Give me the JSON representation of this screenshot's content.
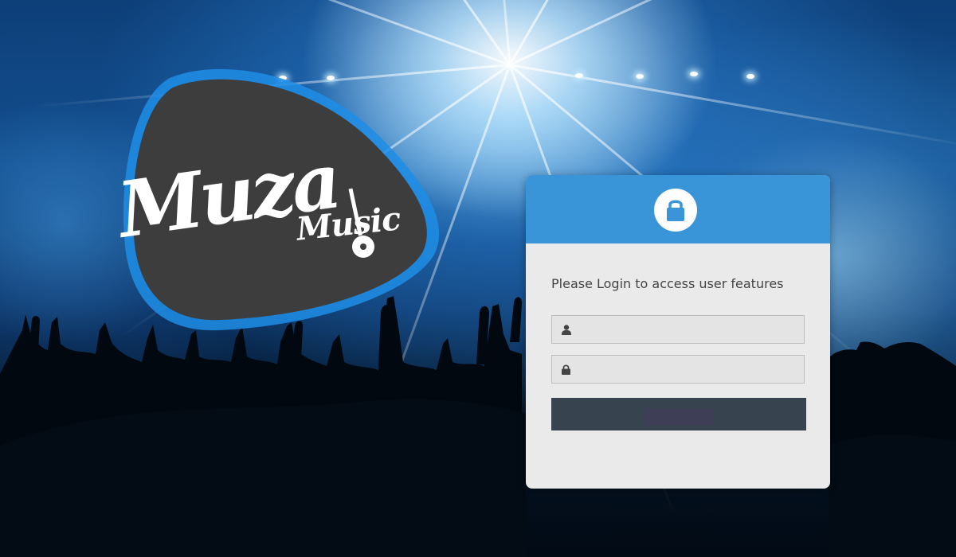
{
  "brand": {
    "name": "Muza",
    "tagline": "Music"
  },
  "login": {
    "message": "Please Login to access user features",
    "username": {
      "value": "",
      "placeholder": "",
      "icon": "user-icon"
    },
    "password": {
      "value": "",
      "placeholder": "",
      "icon": "lock-icon"
    },
    "submit_label": "",
    "header_icon": "lock-icon"
  },
  "colors": {
    "header": "#3a95d8",
    "card": "#eaeaea",
    "button": "#37434e",
    "logo_pick": "#3d3d3d",
    "logo_glow": "#1e8ee6"
  }
}
